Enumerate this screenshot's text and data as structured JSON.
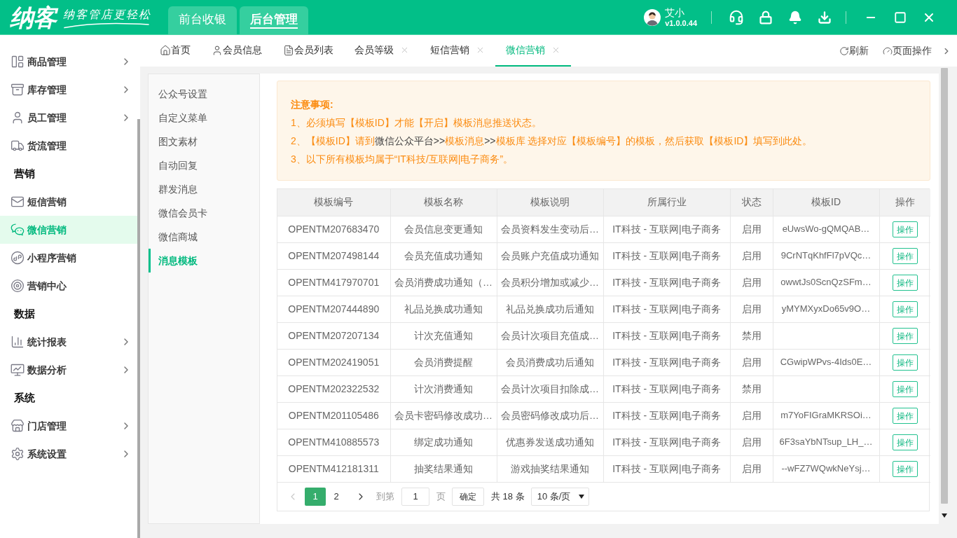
{
  "header": {
    "logo": "纳客",
    "slogan": "纳客管店更轻松",
    "tabs": [
      {
        "label": "前台收银",
        "selected": false
      },
      {
        "label": "后台管理",
        "selected": true
      }
    ],
    "user": {
      "name": "艾小",
      "version": "v1.0.0.44"
    }
  },
  "sidebar": {
    "items": [
      {
        "kind": "item",
        "label": "商品管理",
        "has_submenu": true,
        "selected": false
      },
      {
        "kind": "item",
        "label": "库存管理",
        "has_submenu": true,
        "selected": false
      },
      {
        "kind": "item",
        "label": "员工管理",
        "has_submenu": true,
        "selected": false
      },
      {
        "kind": "item",
        "label": "货流管理",
        "has_submenu": false,
        "selected": false
      },
      {
        "kind": "section",
        "label": "营销"
      },
      {
        "kind": "item",
        "label": "短信营销",
        "has_submenu": false,
        "selected": false
      },
      {
        "kind": "item",
        "label": "微信营销",
        "has_submenu": false,
        "selected": true
      },
      {
        "kind": "item",
        "label": "小程序营销",
        "has_submenu": false,
        "selected": false
      },
      {
        "kind": "item",
        "label": "营销中心",
        "has_submenu": false,
        "selected": false
      },
      {
        "kind": "section",
        "label": "数据"
      },
      {
        "kind": "item",
        "label": "统计报表",
        "has_submenu": true,
        "selected": false
      },
      {
        "kind": "item",
        "label": "数据分析",
        "has_submenu": true,
        "selected": false
      },
      {
        "kind": "section",
        "label": "系统"
      },
      {
        "kind": "item",
        "label": "门店管理",
        "has_submenu": true,
        "selected": false
      },
      {
        "kind": "item",
        "label": "系统设置",
        "has_submenu": true,
        "selected": false
      }
    ]
  },
  "page_tabs": [
    {
      "label": "首页",
      "closable": false,
      "selected": false
    },
    {
      "label": "会员信息",
      "closable": false,
      "selected": false
    },
    {
      "label": "会员列表",
      "closable": false,
      "selected": false
    },
    {
      "label": "会员等级",
      "closable": true,
      "selected": false
    },
    {
      "label": "短信营销",
      "closable": true,
      "selected": false
    },
    {
      "label": "微信营销",
      "closable": true,
      "selected": true
    }
  ],
  "page_actions": [
    "刷新",
    "页面操作"
  ],
  "submenu": [
    {
      "label": "公众号设置",
      "selected": false
    },
    {
      "label": "自定义菜单",
      "selected": false
    },
    {
      "label": "图文素材",
      "selected": false
    },
    {
      "label": "自动回复",
      "selected": false
    },
    {
      "label": "群发消息",
      "selected": false
    },
    {
      "label": "微信会员卡",
      "selected": false
    },
    {
      "label": "微信商城",
      "selected": false
    },
    {
      "label": "消息模板",
      "selected": true
    }
  ],
  "notice": {
    "title": "注意事项:",
    "lines": [
      {
        "segments": [
          {
            "text": "1、必须填写【模板ID】才能【开启】模板消息推送状态。",
            "kind": "accent"
          }
        ]
      },
      {
        "segments": [
          {
            "text": "2、【模板ID】请到",
            "kind": "accent"
          },
          {
            "text": "微信公众平台>>",
            "kind": "plain"
          },
          {
            "text": "模板消息",
            "kind": "accent"
          },
          {
            "text": ">>",
            "kind": "plain"
          },
          {
            "text": "模板库 选择对应【模板编号】的模板，然后获取【模板ID】填写到此处。",
            "kind": "accent"
          }
        ]
      },
      {
        "segments": [
          {
            "text": "3、以下所有模板均属于“IT科技/互联网|电子商务”。",
            "kind": "accent"
          }
        ]
      }
    ]
  },
  "table": {
    "columns": [
      "模板编号",
      "模板名称",
      "模板说明",
      "所属行业",
      "状态",
      "模板ID",
      "操作"
    ],
    "rows": [
      {
        "code": "OPENTM207683470",
        "name": "会员信息变更通知",
        "description": "会员资料发生变动后…",
        "industry": "IT科技 - 互联网|电子商务",
        "status": "启用",
        "template_id": "eUwsWo-gQMQAB…",
        "action": "操作"
      },
      {
        "code": "OPENTM207498144",
        "name": "会员充值成功通知",
        "description": "会员账户充值成功通知",
        "industry": "IT科技 - 互联网|电子商务",
        "status": "启用",
        "template_id": "9CrNTqKhfFl7pVQc…",
        "action": "操作"
      },
      {
        "code": "OPENTM417970701",
        "name": "会员消费成功通知（…",
        "description": "会员积分增加或减少…",
        "industry": "IT科技 - 互联网|电子商务",
        "status": "启用",
        "template_id": "owwtJs0ScnQzSFm…",
        "action": "操作"
      },
      {
        "code": "OPENTM207444890",
        "name": "礼品兑换成功通知",
        "description": "礼品兑换成功后通知",
        "industry": "IT科技 - 互联网|电子商务",
        "status": "启用",
        "template_id": "yMYMXyxDo65v9O…",
        "action": "操作"
      },
      {
        "code": "OPENTM207207134",
        "name": "计次充值通知",
        "description": "会员计次项目充值成…",
        "industry": "IT科技 - 互联网|电子商务",
        "status": "禁用",
        "action": "操作"
      },
      {
        "code": "OPENTM202419051",
        "name": "会员消费提醒",
        "description": "会员消费成功后通知",
        "industry": "IT科技 - 互联网|电子商务",
        "status": "启用",
        "template_id": "CGwipWPvs-4Ids0E…",
        "action": "操作"
      },
      {
        "code": "OPENTM202322532",
        "name": "计次消费通知",
        "description": "会员计次项目扣除成…",
        "industry": "IT科技 - 互联网|电子商务",
        "status": "禁用",
        "action": "操作"
      },
      {
        "code": "OPENTM201105486",
        "name": "会员卡密码修改成功…",
        "description": "会员密码修改成功后…",
        "industry": "IT科技 - 互联网|电子商务",
        "status": "启用",
        "template_id": "m7YoFIGraMKRSOi…",
        "action": "操作"
      },
      {
        "code": "OPENTM410885573",
        "name": "绑定成功通知",
        "description": "优惠券发送成功通知",
        "industry": "IT科技 - 互联网|电子商务",
        "status": "启用",
        "template_id": "6F3saYbNTsup_LH_…",
        "action": "操作"
      },
      {
        "code": "OPENTM412181311",
        "name": "抽奖结果通知",
        "description": "游戏抽奖结果通知",
        "industry": "IT科技 - 互联网|电子商务",
        "status": "启用",
        "template_id": "--wFZ7WQwkNeYsj…",
        "action": "操作"
      }
    ]
  },
  "pagination": {
    "prev": {
      "disabled": true
    },
    "pages": [
      {
        "label": "1",
        "selected": true
      },
      {
        "label": "2",
        "selected": false
      }
    ],
    "next": {
      "disabled": false
    },
    "goto_label": "到第",
    "page_input": "1",
    "page_unit": "页",
    "confirm": "确定",
    "total": "共 18 条",
    "page_size": "10 条/页"
  }
}
